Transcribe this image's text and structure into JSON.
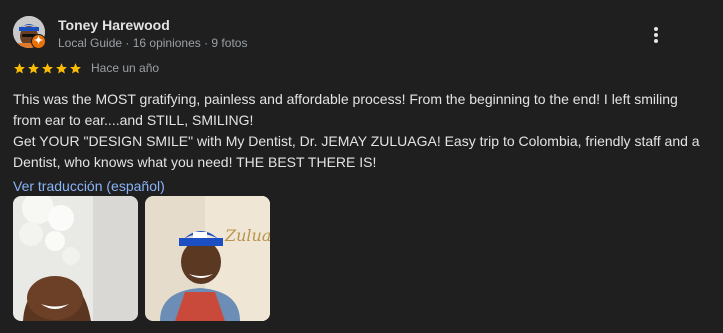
{
  "reviewer": {
    "name": "Toney Harewood",
    "meta": "Local Guide · 16 opiniones · 9 fotos",
    "badge_color": "#e8710a"
  },
  "rating": {
    "stars": 5,
    "star_color": "#fbbc04",
    "date": "Hace un año"
  },
  "review": {
    "lines": [
      "This was the MOST gratifying, painless and affordable process! From the beginning to the end! I left smiling from ear to ear....and STILL, SMILING!",
      "Get YOUR \"DESIGN SMILE\" with My Dentist, Dr. JEMAY ZULUAGA! Easy trip to Colombia, friendly staff and a Dentist, who knows what you need! THE BEST THERE IS!"
    ]
  },
  "translate_link": "Ver traducción (español)",
  "photos": [
    {
      "icon": "photo-thumbnail-smile"
    },
    {
      "icon": "photo-thumbnail-portrait",
      "sign_text": "Zuluaga"
    }
  ],
  "colors": {
    "background": "#1f1f1f",
    "text": "#e3e3e3",
    "secondary_text": "#9aa0a6",
    "link": "#8ab4f8"
  }
}
